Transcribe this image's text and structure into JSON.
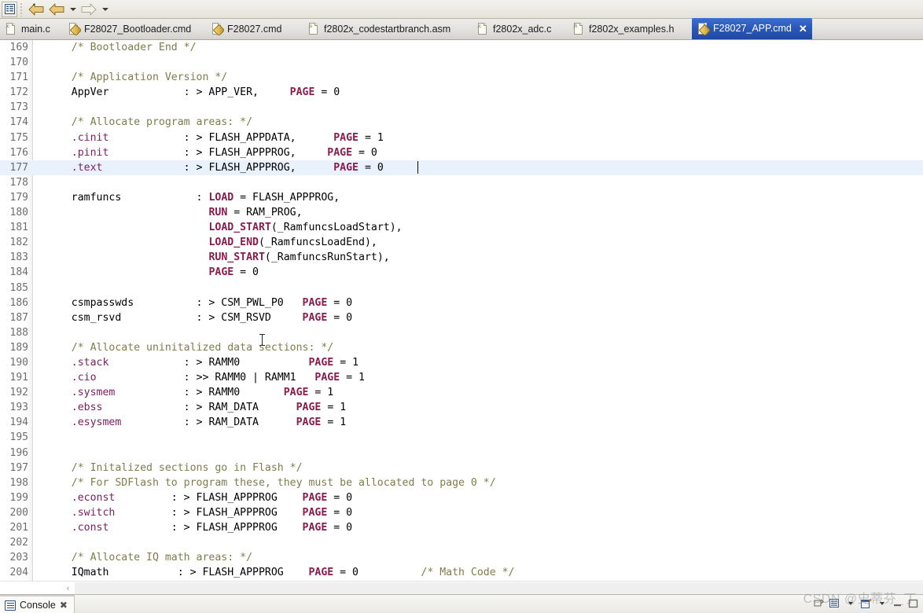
{
  "toolbar": {
    "buttons": [
      {
        "name": "outline-view-button",
        "icon": "list-view-icon"
      },
      {
        "name": "back-button",
        "icon": "back-arrow-icon"
      },
      {
        "name": "back-history-dropdown",
        "icon": "chevron-down-icon"
      },
      {
        "name": "forward-button",
        "icon": "forward-arrow-icon"
      },
      {
        "name": "forward-history-dropdown",
        "icon": "chevron-down-icon"
      }
    ]
  },
  "tabs": [
    {
      "label": "main.c",
      "icon": "c-file-icon",
      "tag": ".c",
      "active": false
    },
    {
      "label": "F28027_Bootloader.cmd",
      "icon": "cmd-file-icon",
      "tag": "",
      "active": false
    },
    {
      "label": "F28027.cmd",
      "icon": "cmd-file-icon",
      "tag": "",
      "active": false
    },
    {
      "label": "f2802x_codestartbranch.asm",
      "icon": "asm-file-icon",
      "tag": ".s",
      "active": false
    },
    {
      "label": "f2802x_adc.c",
      "icon": "c-file-icon",
      "tag": ".c",
      "active": false
    },
    {
      "label": "f2802x_examples.h",
      "icon": "h-file-icon",
      "tag": ".h",
      "active": false
    },
    {
      "label": "F28027_APP.cmd",
      "icon": "cmd-file-icon",
      "tag": "",
      "active": true,
      "close_label": "✕"
    }
  ],
  "editor": {
    "highlighted_line": 177,
    "caret_line": 177,
    "caret_column": 63,
    "colors": {
      "comment": "#7d7d4c",
      "section": "#7d2060",
      "keyword": "#8c1b4d",
      "plain": "#000000",
      "line_number": "#6d6d6d",
      "highlight_bg": "#e8f1fc"
    },
    "lines": [
      {
        "n": 169,
        "tokens": [
          {
            "t": "    /* Bootloader End */",
            "c": "cm"
          }
        ]
      },
      {
        "n": 170,
        "tokens": []
      },
      {
        "n": 171,
        "tokens": [
          {
            "t": "    /* Application Version */",
            "c": "cm"
          }
        ]
      },
      {
        "n": 172,
        "tokens": [
          {
            "t": "    AppVer            : > APP_VER,     ",
            "c": "pl"
          },
          {
            "t": "PAGE",
            "c": "kw"
          },
          {
            "t": " = 0",
            "c": "pl"
          }
        ]
      },
      {
        "n": 173,
        "tokens": []
      },
      {
        "n": 174,
        "tokens": [
          {
            "t": "    /* Allocate program areas: */",
            "c": "cm"
          }
        ]
      },
      {
        "n": 175,
        "tokens": [
          {
            "t": "    ",
            "c": "pl"
          },
          {
            "t": ".cinit",
            "c": "sec"
          },
          {
            "t": "            : > FLASH_APPDATA,      ",
            "c": "pl"
          },
          {
            "t": "PAGE",
            "c": "kw"
          },
          {
            "t": " = 1",
            "c": "pl"
          }
        ]
      },
      {
        "n": 176,
        "tokens": [
          {
            "t": "    ",
            "c": "pl"
          },
          {
            "t": ".pinit",
            "c": "sec"
          },
          {
            "t": "            : > FLASH_APPPROG,     ",
            "c": "pl"
          },
          {
            "t": "PAGE",
            "c": "kw"
          },
          {
            "t": " = 0",
            "c": "pl"
          }
        ]
      },
      {
        "n": 177,
        "tokens": [
          {
            "t": "    ",
            "c": "pl"
          },
          {
            "t": ".text",
            "c": "sec"
          },
          {
            "t": "             : > FLASH_APPPROG,      ",
            "c": "pl"
          },
          {
            "t": "PAGE",
            "c": "kw"
          },
          {
            "t": " = 0",
            "c": "pl"
          }
        ]
      },
      {
        "n": 178,
        "tokens": []
      },
      {
        "n": 179,
        "tokens": [
          {
            "t": "    ramfuncs            : ",
            "c": "pl"
          },
          {
            "t": "LOAD",
            "c": "kw"
          },
          {
            "t": " = FLASH_APPPROG,",
            "c": "pl"
          }
        ]
      },
      {
        "n": 180,
        "tokens": [
          {
            "t": "                          ",
            "c": "pl"
          },
          {
            "t": "RUN",
            "c": "kw"
          },
          {
            "t": " = RAM_PROG,",
            "c": "pl"
          }
        ]
      },
      {
        "n": 181,
        "tokens": [
          {
            "t": "                          ",
            "c": "pl"
          },
          {
            "t": "LOAD_START",
            "c": "kw"
          },
          {
            "t": "(_RamfuncsLoadStart),",
            "c": "pl"
          }
        ]
      },
      {
        "n": 182,
        "tokens": [
          {
            "t": "                          ",
            "c": "pl"
          },
          {
            "t": "LOAD_END",
            "c": "kw"
          },
          {
            "t": "(_RamfuncsLoadEnd),",
            "c": "pl"
          }
        ]
      },
      {
        "n": 183,
        "tokens": [
          {
            "t": "                          ",
            "c": "pl"
          },
          {
            "t": "RUN_START",
            "c": "kw"
          },
          {
            "t": "(_RamfuncsRunStart),",
            "c": "pl"
          }
        ]
      },
      {
        "n": 184,
        "tokens": [
          {
            "t": "                          ",
            "c": "pl"
          },
          {
            "t": "PAGE",
            "c": "kw"
          },
          {
            "t": " = 0",
            "c": "pl"
          }
        ]
      },
      {
        "n": 185,
        "tokens": []
      },
      {
        "n": 186,
        "tokens": [
          {
            "t": "    csmpasswds          : > CSM_PWL_P0   ",
            "c": "pl"
          },
          {
            "t": "PAGE",
            "c": "kw"
          },
          {
            "t": " = 0",
            "c": "pl"
          }
        ]
      },
      {
        "n": 187,
        "tokens": [
          {
            "t": "    csm_rsvd            : > CSM_RSVD     ",
            "c": "pl"
          },
          {
            "t": "PAGE",
            "c": "kw"
          },
          {
            "t": " = 0",
            "c": "pl"
          }
        ]
      },
      {
        "n": 188,
        "tokens": []
      },
      {
        "n": 189,
        "tokens": [
          {
            "t": "    /* Allocate uninitalized data sections: */",
            "c": "cm"
          }
        ]
      },
      {
        "n": 190,
        "tokens": [
          {
            "t": "    ",
            "c": "pl"
          },
          {
            "t": ".stack",
            "c": "sec"
          },
          {
            "t": "            : > RAMM0           ",
            "c": "pl"
          },
          {
            "t": "PAGE",
            "c": "kw"
          },
          {
            "t": " = 1",
            "c": "pl"
          }
        ]
      },
      {
        "n": 191,
        "tokens": [
          {
            "t": "    ",
            "c": "pl"
          },
          {
            "t": ".cio",
            "c": "sec"
          },
          {
            "t": "              : >> RAMM0 | RAMM1   ",
            "c": "pl"
          },
          {
            "t": "PAGE",
            "c": "kw"
          },
          {
            "t": " = 1",
            "c": "pl"
          }
        ]
      },
      {
        "n": 192,
        "tokens": [
          {
            "t": "    ",
            "c": "pl"
          },
          {
            "t": ".sysmem",
            "c": "sec"
          },
          {
            "t": "           : > RAMM0       ",
            "c": "pl"
          },
          {
            "t": "PAGE",
            "c": "kw"
          },
          {
            "t": " = 1",
            "c": "pl"
          }
        ]
      },
      {
        "n": 193,
        "tokens": [
          {
            "t": "    ",
            "c": "pl"
          },
          {
            "t": ".ebss",
            "c": "sec"
          },
          {
            "t": "             : > RAM_DATA      ",
            "c": "pl"
          },
          {
            "t": "PAGE",
            "c": "kw"
          },
          {
            "t": " = 1",
            "c": "pl"
          }
        ]
      },
      {
        "n": 194,
        "tokens": [
          {
            "t": "    ",
            "c": "pl"
          },
          {
            "t": ".esysmem",
            "c": "sec"
          },
          {
            "t": "          : > RAM_DATA      ",
            "c": "pl"
          },
          {
            "t": "PAGE",
            "c": "kw"
          },
          {
            "t": " = 1",
            "c": "pl"
          }
        ]
      },
      {
        "n": 195,
        "tokens": []
      },
      {
        "n": 196,
        "tokens": []
      },
      {
        "n": 197,
        "tokens": [
          {
            "t": "    /* Initalized sections go in Flash */",
            "c": "cm"
          }
        ]
      },
      {
        "n": 198,
        "tokens": [
          {
            "t": "    /* For SDFlash to program these, they must be allocated to page 0 */",
            "c": "cm"
          }
        ]
      },
      {
        "n": 199,
        "tokens": [
          {
            "t": "    ",
            "c": "pl"
          },
          {
            "t": ".econst",
            "c": "sec"
          },
          {
            "t": "         : > FLASH_APPPROG    ",
            "c": "pl"
          },
          {
            "t": "PAGE",
            "c": "kw"
          },
          {
            "t": " = 0",
            "c": "pl"
          }
        ]
      },
      {
        "n": 200,
        "tokens": [
          {
            "t": "    ",
            "c": "pl"
          },
          {
            "t": ".switch",
            "c": "sec"
          },
          {
            "t": "         : > FLASH_APPPROG    ",
            "c": "pl"
          },
          {
            "t": "PAGE",
            "c": "kw"
          },
          {
            "t": " = 0",
            "c": "pl"
          }
        ]
      },
      {
        "n": 201,
        "tokens": [
          {
            "t": "    ",
            "c": "pl"
          },
          {
            "t": ".const",
            "c": "sec"
          },
          {
            "t": "          : > FLASH_APPPROG    ",
            "c": "pl"
          },
          {
            "t": "PAGE",
            "c": "kw"
          },
          {
            "t": " = 0",
            "c": "pl"
          }
        ]
      },
      {
        "n": 202,
        "tokens": []
      },
      {
        "n": 203,
        "tokens": [
          {
            "t": "    /* Allocate IQ math areas: */",
            "c": "cm"
          }
        ]
      },
      {
        "n": 204,
        "tokens": [
          {
            "t": "    IQmath           : > FLASH_APPPROG    ",
            "c": "pl"
          },
          {
            "t": "PAGE",
            "c": "kw"
          },
          {
            "t": " = 0",
            "c": "pl"
          },
          {
            "t": "          /* Math Code */",
            "c": "cm"
          }
        ]
      }
    ]
  },
  "scrollbar": {
    "left_arrow": "‹",
    "name": "horizontal-scrollbar"
  },
  "bottom_panel": {
    "console_tab_label": "Console",
    "console_pin_label": "✖",
    "tools": [
      {
        "name": "terminate-button",
        "glyph": "■"
      },
      {
        "name": "display-selected-console-button",
        "glyph": "☰"
      },
      {
        "name": "display-selected-console-dropdown",
        "glyph": "▼"
      },
      {
        "name": "open-console-button",
        "glyph": "⬜"
      },
      {
        "name": "open-console-dropdown",
        "glyph": "▼"
      },
      {
        "name": "minimize-button",
        "glyph": "─"
      },
      {
        "name": "maximize-button",
        "glyph": "□"
      }
    ]
  },
  "watermark": {
    "text": "CSDN @史蒂芬_丁"
  }
}
